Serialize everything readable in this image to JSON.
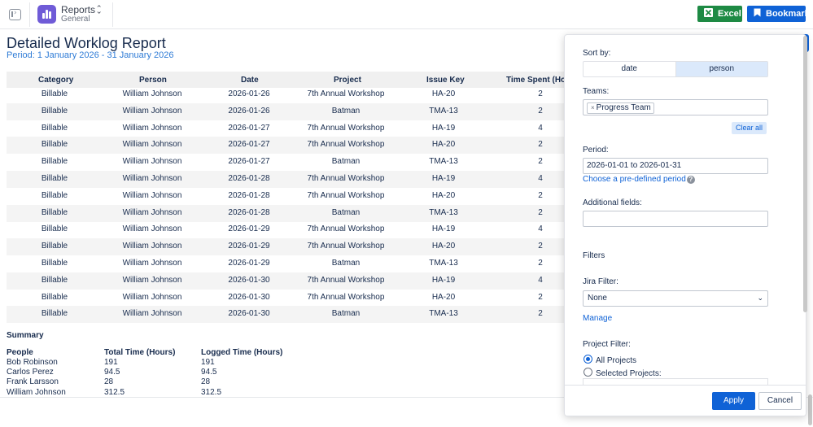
{
  "topbar": {
    "app_title": "Reports",
    "app_subtitle": "General",
    "excel_label": "Excel",
    "bookmark_label": "Bookmark",
    "excel_color": "#1e8a44",
    "bookmark_color": "#0f62d6",
    "app_icon_color": "#6f5bd7"
  },
  "report": {
    "title": "Detailed Worklog Report",
    "period": "Period: 1 January 2026 - 31 January 2026"
  },
  "table": {
    "headers": [
      "Category",
      "Person",
      "Date",
      "Project",
      "Issue Key",
      "Time Spent (Hou"
    ],
    "rows": [
      [
        "Billable",
        "William Johnson",
        "2026-01-26",
        "7th Annual Workshop",
        "HA-20",
        "2"
      ],
      [
        "Billable",
        "William Johnson",
        "2026-01-26",
        "Batman",
        "TMA-13",
        "2"
      ],
      [
        "Billable",
        "William Johnson",
        "2026-01-27",
        "7th Annual Workshop",
        "HA-19",
        "4"
      ],
      [
        "Billable",
        "William Johnson",
        "2026-01-27",
        "7th Annual Workshop",
        "HA-20",
        "2"
      ],
      [
        "Billable",
        "William Johnson",
        "2026-01-27",
        "Batman",
        "TMA-13",
        "2"
      ],
      [
        "Billable",
        "William Johnson",
        "2026-01-28",
        "7th Annual Workshop",
        "HA-19",
        "4"
      ],
      [
        "Billable",
        "William Johnson",
        "2026-01-28",
        "7th Annual Workshop",
        "HA-20",
        "2"
      ],
      [
        "Billable",
        "William Johnson",
        "2026-01-28",
        "Batman",
        "TMA-13",
        "2"
      ],
      [
        "Billable",
        "William Johnson",
        "2026-01-29",
        "7th Annual Workshop",
        "HA-19",
        "4"
      ],
      [
        "Billable",
        "William Johnson",
        "2026-01-29",
        "7th Annual Workshop",
        "HA-20",
        "2"
      ],
      [
        "Billable",
        "William Johnson",
        "2026-01-29",
        "Batman",
        "TMA-13",
        "2"
      ],
      [
        "Billable",
        "William Johnson",
        "2026-01-30",
        "7th Annual Workshop",
        "HA-19",
        "4"
      ],
      [
        "Billable",
        "William Johnson",
        "2026-01-30",
        "7th Annual Workshop",
        "HA-20",
        "2"
      ],
      [
        "Billable",
        "William Johnson",
        "2026-01-30",
        "Batman",
        "TMA-13",
        "2"
      ]
    ]
  },
  "summary": {
    "title": "Summary",
    "headers": [
      "People",
      "Total Time (Hours)",
      "Logged Time (Hours)"
    ],
    "rows": [
      [
        "Bob Robinson",
        "191",
        "191"
      ],
      [
        "Carlos Perez",
        "94.5",
        "94.5"
      ],
      [
        "Frank Larsson",
        "28",
        "28"
      ],
      [
        "William Johnson",
        "312.5",
        "312.5"
      ]
    ]
  },
  "panel": {
    "sort_label": "Sort by:",
    "sort_options": [
      "date",
      "person"
    ],
    "sort_selected": "person",
    "teams_label": "Teams:",
    "team_chip": "Progress Team",
    "team_chip_remove": "×",
    "clear_all": "Clear all",
    "period_label": "Period:",
    "period_value": "2026-01-01 to 2026-01-31",
    "predefined_link": "Choose a pre-defined period",
    "help_glyph": "?",
    "additional_label": "Additional fields:",
    "additional_value": "",
    "filters_label": "Filters",
    "jira_filter_label": "Jira Filter:",
    "jira_filter_value": "None",
    "manage_link": "Manage",
    "project_filter_label": "Project Filter:",
    "radio_all": "All Projects",
    "radio_selected": "Selected Projects:",
    "apply_label": "Apply",
    "cancel_label": "Cancel"
  }
}
